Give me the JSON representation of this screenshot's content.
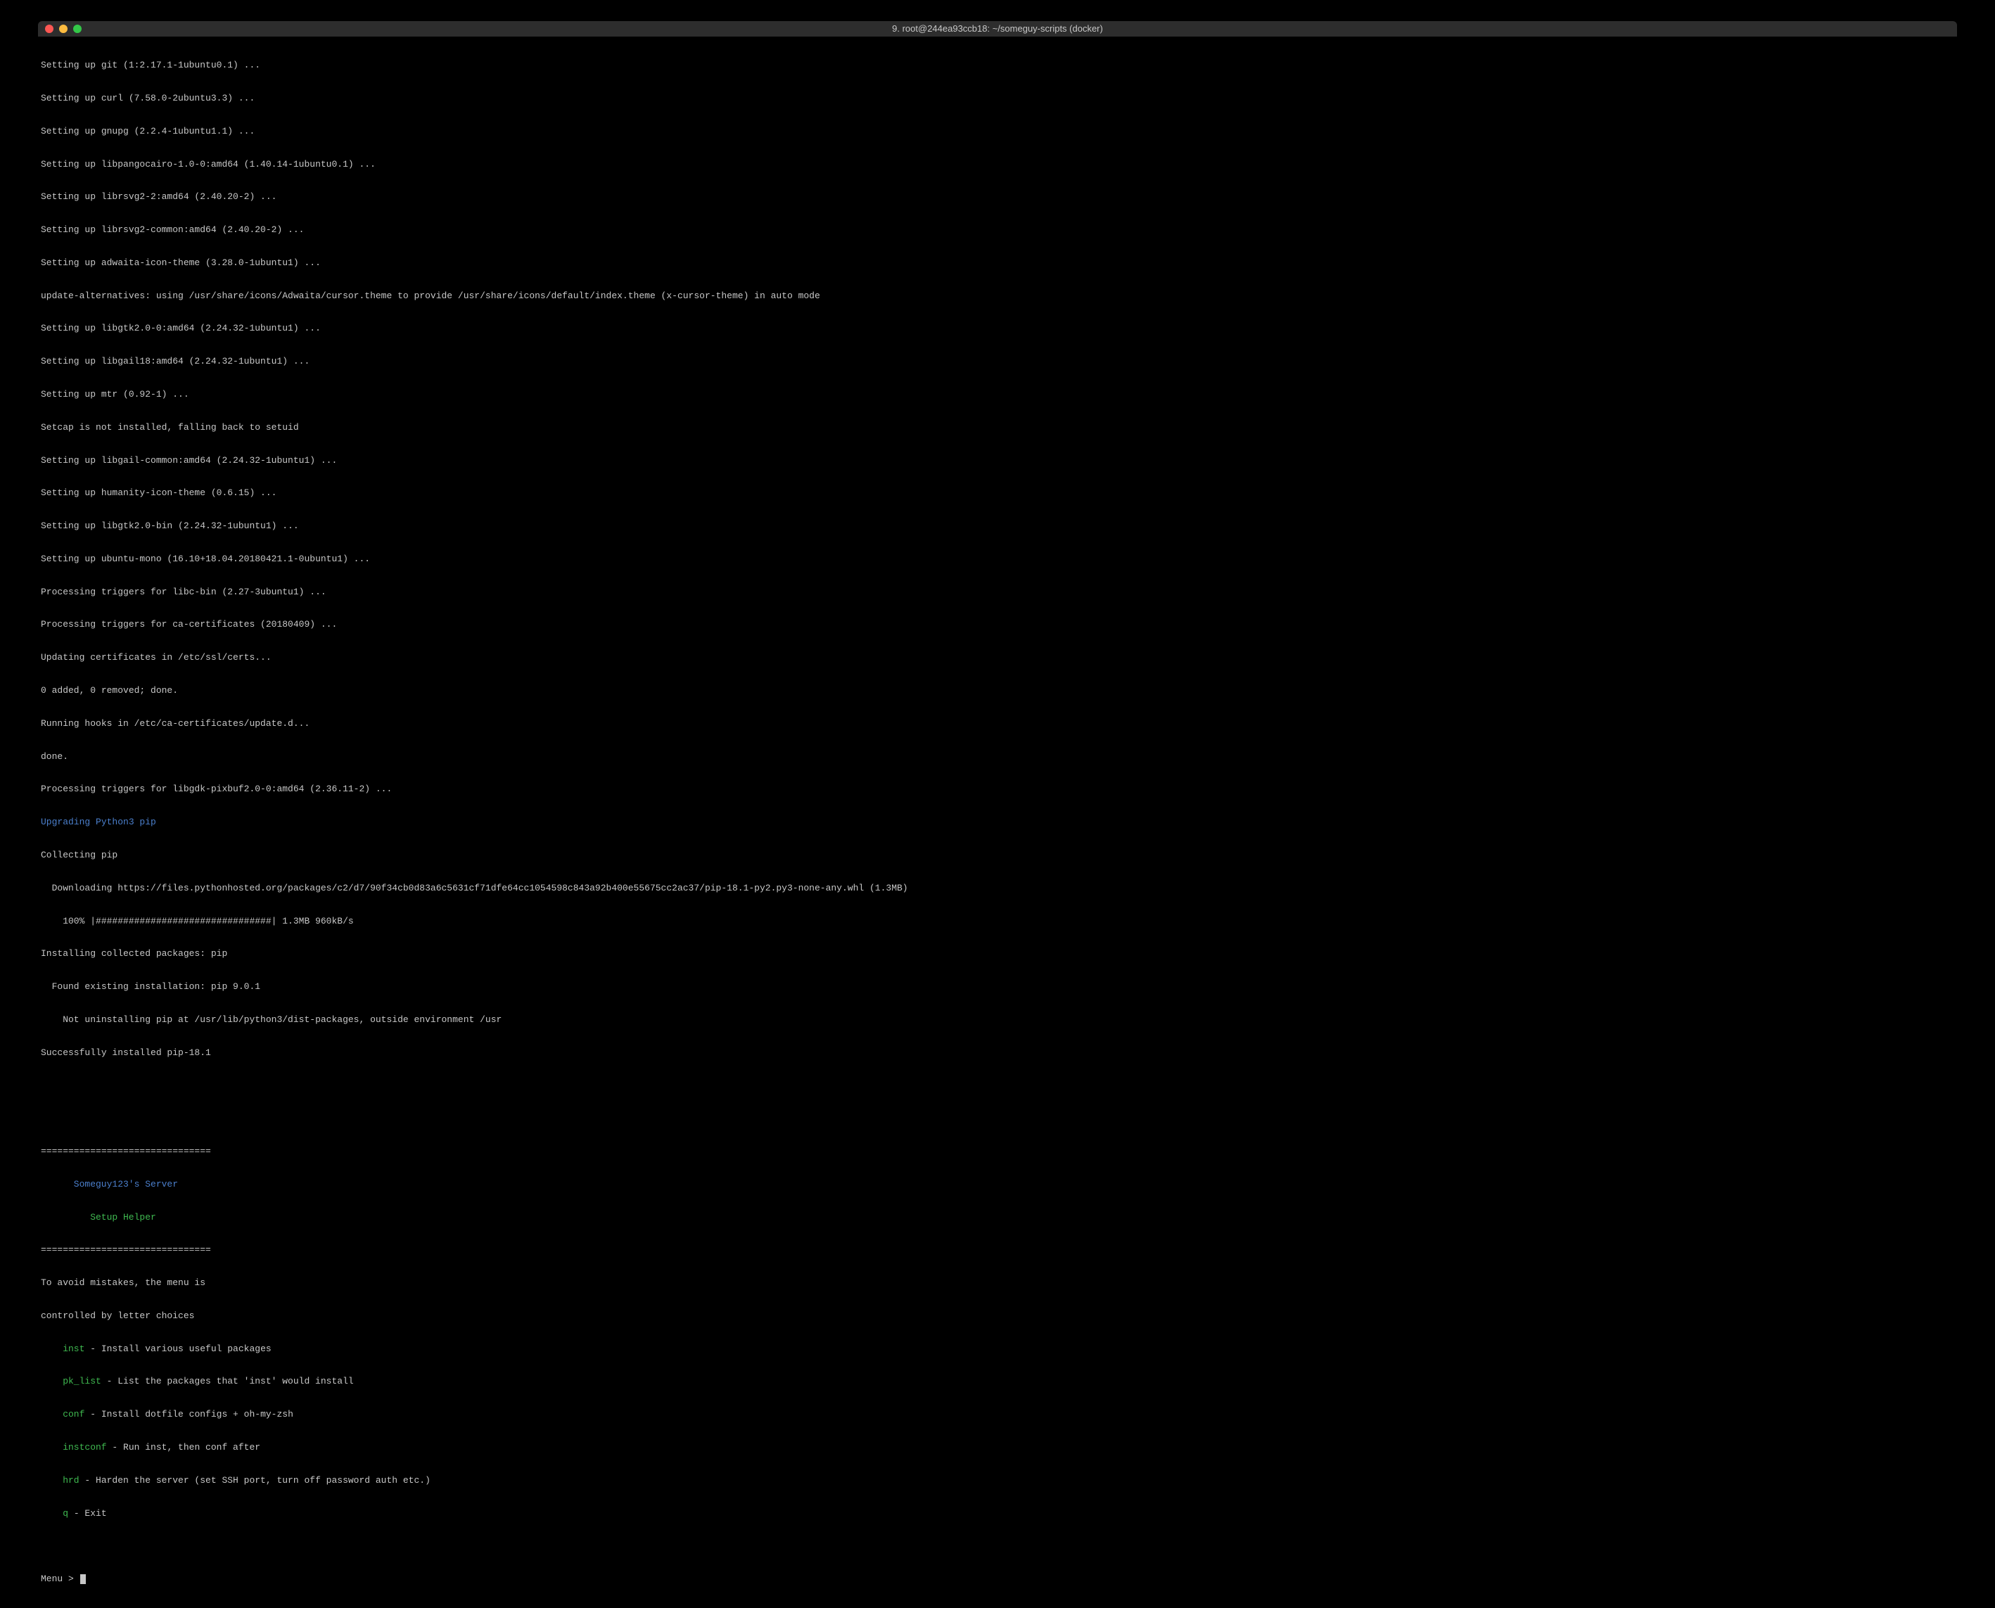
{
  "titlebar": {
    "title": "9. root@244ea93ccb18: ~/someguy-scripts (docker)"
  },
  "output": {
    "l0": "Setting up git (1:2.17.1-1ubuntu0.1) ...",
    "l1": "Setting up curl (7.58.0-2ubuntu3.3) ...",
    "l2": "Setting up gnupg (2.2.4-1ubuntu1.1) ...",
    "l3": "Setting up libpangocairo-1.0-0:amd64 (1.40.14-1ubuntu0.1) ...",
    "l4": "Setting up librsvg2-2:amd64 (2.40.20-2) ...",
    "l5": "Setting up librsvg2-common:amd64 (2.40.20-2) ...",
    "l6": "Setting up adwaita-icon-theme (3.28.0-1ubuntu1) ...",
    "l7": "update-alternatives: using /usr/share/icons/Adwaita/cursor.theme to provide /usr/share/icons/default/index.theme (x-cursor-theme) in auto mode",
    "l8": "Setting up libgtk2.0-0:amd64 (2.24.32-1ubuntu1) ...",
    "l9": "Setting up libgail18:amd64 (2.24.32-1ubuntu1) ...",
    "l10": "Setting up mtr (0.92-1) ...",
    "l11": "Setcap is not installed, falling back to setuid",
    "l12": "Setting up libgail-common:amd64 (2.24.32-1ubuntu1) ...",
    "l13": "Setting up humanity-icon-theme (0.6.15) ...",
    "l14": "Setting up libgtk2.0-bin (2.24.32-1ubuntu1) ...",
    "l15": "Setting up ubuntu-mono (16.10+18.04.20180421.1-0ubuntu1) ...",
    "l16": "Processing triggers for libc-bin (2.27-3ubuntu1) ...",
    "l17": "Processing triggers for ca-certificates (20180409) ...",
    "l18": "Updating certificates in /etc/ssl/certs...",
    "l19": "0 added, 0 removed; done.",
    "l20": "Running hooks in /etc/ca-certificates/update.d...",
    "l21": "done.",
    "l22": "Processing triggers for libgdk-pixbuf2.0-0:amd64 (2.36.11-2) ...",
    "l23": "Upgrading Python3 pip",
    "l24": "Collecting pip",
    "l25": "  Downloading https://files.pythonhosted.org/packages/c2/d7/90f34cb0d83a6c5631cf71dfe64cc1054598c843a92b400e55675cc2ac37/pip-18.1-py2.py3-none-any.whl (1.3MB)",
    "l26": "    100% |################################| 1.3MB 960kB/s",
    "l27": "Installing collected packages: pip",
    "l28": "  Found existing installation: pip 9.0.1",
    "l29": "    Not uninstalling pip at /usr/lib/python3/dist-packages, outside environment /usr",
    "l30": "Successfully installed pip-18.1"
  },
  "menu": {
    "divider": "===============================",
    "header1": "Someguy123's Server",
    "header2": "Setup Helper",
    "intro1": "To avoid mistakes, the menu is",
    "intro2": "controlled by letter choices",
    "items": [
      {
        "cmd": "inst",
        "desc": " - Install various useful packages"
      },
      {
        "cmd": "pk_list",
        "desc": " - List the packages that 'inst' would install"
      },
      {
        "cmd": "conf",
        "desc": " - Install dotfile configs + oh-my-zsh"
      },
      {
        "cmd": "instconf",
        "desc": " - Run inst, then conf after"
      },
      {
        "cmd": "hrd",
        "desc": " - Harden the server (set SSH port, turn off password auth etc.)"
      },
      {
        "cmd": "q",
        "desc": " - Exit"
      }
    ],
    "prompt": "Menu > "
  }
}
